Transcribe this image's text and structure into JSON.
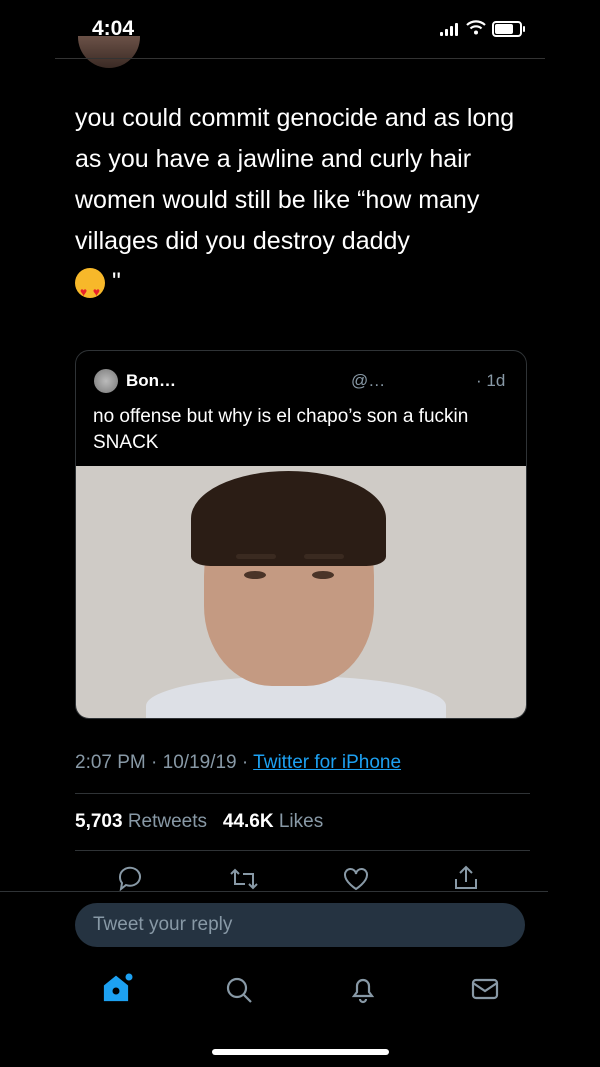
{
  "status_bar": {
    "time": "4:04"
  },
  "tweet": {
    "text": "you could commit genocide and as long as you have a jawline and curly hair women would still be like “how many villages did you destroy daddy",
    "emoji_name": "heart-eyes-emoji",
    "closing_quote": "\""
  },
  "quoted_tweet": {
    "name": "Bon…",
    "handle": "@…",
    "time": "· 1d",
    "text": "no offense but why is el chapo’s son a fuckin SNACK",
    "photo_subject": "man-portrait-photo"
  },
  "meta": {
    "time": "2:07 PM",
    "separator": "·",
    "date": "10/19/19",
    "source": "Twitter for iPhone"
  },
  "stats": {
    "retweets_count": "5,703",
    "retweets_label": "Retweets",
    "likes_count": "44.6K",
    "likes_label": "Likes"
  },
  "reply": {
    "placeholder": "Tweet your reply"
  },
  "colors": {
    "accent": "#1da1f2",
    "muted": "#8899a6",
    "background": "#000000"
  }
}
